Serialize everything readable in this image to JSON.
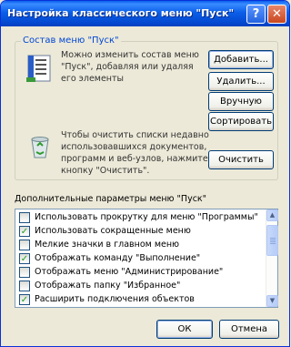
{
  "window": {
    "title": "Настройка классического меню \"Пуск\"",
    "help_glyph": "?",
    "close_glyph": "✕"
  },
  "menu_group": {
    "label": "Состав меню \"Пуск\"",
    "description": [
      "Можно изменить состав меню",
      "\"Пуск\", добавляя или удаляя",
      "его элементы"
    ],
    "clear_description": [
      "Чтобы очистить списки недавно",
      "использовавшихся документов,",
      "программ и веб-узлов, нажмите",
      "кнопку \"Очистить\"."
    ],
    "buttons": {
      "add": "Добавить...",
      "remove": "Удалить...",
      "manual": "Вручную",
      "sort": "Сортировать",
      "clear": "Очистить"
    }
  },
  "advanced": {
    "label": "Дополнительные параметры меню \"Пуск\"",
    "items": [
      {
        "label": "Использовать прокрутку для меню \"Программы\"",
        "checked": false
      },
      {
        "label": "Использовать сокращенные меню",
        "checked": true
      },
      {
        "label": "Мелкие значки в главном меню",
        "checked": false
      },
      {
        "label": "Отображать команду \"Выполнение\"",
        "checked": true
      },
      {
        "label": "Отображать меню \"Администрирование\"",
        "checked": false
      },
      {
        "label": "Отображать папку \"Избранное\"",
        "checked": false
      },
      {
        "label": "Расширить подключения объектов",
        "checked": true
      }
    ]
  },
  "footer": {
    "ok": "ОК",
    "cancel": "Отмена"
  }
}
